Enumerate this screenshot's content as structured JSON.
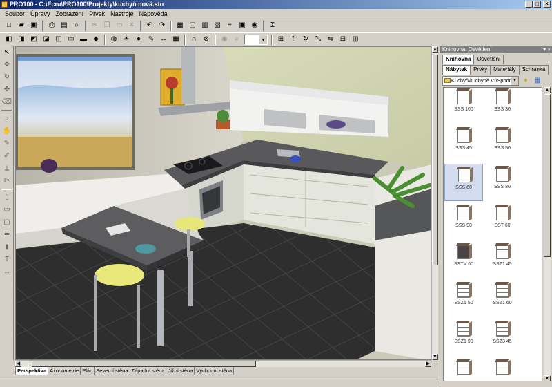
{
  "window": {
    "title": "PRO100 - C:\\Ecru\\PRO100\\Projekty\\kuchyň nová.sto",
    "controls": [
      "_",
      "□",
      "×"
    ]
  },
  "menu": [
    "Soubor",
    "Úpravy",
    "Zobrazení",
    "Prvek",
    "Nástroje",
    "Nápověda"
  ],
  "toolbar1": {
    "icons": [
      "new-doc-icon",
      "open-folder-icon",
      "save-icon",
      "print-preview-icon",
      "print-icon",
      "find-icon",
      "cut-icon",
      "copy-icon",
      "paste-icon",
      "delete-icon",
      "undo-icon",
      "redo-icon",
      "properties-icon",
      "window-icon",
      "layers-icon",
      "group-icon",
      "align-icon",
      "preview-icon",
      "render-icon",
      "sum-icon"
    ],
    "sum_symbol": "Σ"
  },
  "toolbar2": {
    "icons": [
      "view-front-icon",
      "view-left-icon",
      "view-top-icon",
      "view-3d-icon",
      "view-right-icon",
      "view-back-icon",
      "view-bottom-icon",
      "view-iso-icon",
      "camera-icon",
      "light-icon",
      "bulb-icon",
      "paint-icon",
      "measure-icon",
      "grid-icon",
      "magnet-icon",
      "snap-icon",
      "stop-icon",
      "zoom-icon",
      "snap-grid-icon",
      "move-icon",
      "rotate-icon",
      "scale-icon",
      "mirror-icon",
      "distribute-icon",
      "arrange-icon"
    ],
    "zoom_value": ""
  },
  "left_tools": [
    "arrow-icon",
    "select-icon",
    "rotate-tool-icon",
    "move-tool-icon",
    "rubber-icon",
    "zoom-tool-icon",
    "pan-icon",
    "edit-icon",
    "draw-icon",
    "measure-tool-icon",
    "cut-tool-icon",
    "wall-icon",
    "door-icon",
    "window-tool-icon",
    "stairs-icon",
    "column-icon",
    "text-tool-icon",
    "dim-icon"
  ],
  "view_tabs": [
    "Perspektiva",
    "Axonometrie",
    "Plán",
    "Severní stěna",
    "Západní stěna",
    "Jižní stěna",
    "Východní stěna"
  ],
  "active_view_tab": "Perspektiva",
  "panel": {
    "header": "Knihovna, Osvětlení",
    "tabs": [
      "Knihovna",
      "Osvětlení"
    ],
    "subtabs": [
      "Nábytek",
      "Prvky",
      "Materiály",
      "Schránka"
    ],
    "path": "Kuchyň\\kuchyně VI\\Spodní",
    "items": [
      {
        "label": "SSS 100",
        "style": "plain"
      },
      {
        "label": "SSS 30",
        "style": "plain"
      },
      {
        "label": "SSS 45",
        "style": "plain"
      },
      {
        "label": "SSS 50",
        "style": "plain"
      },
      {
        "label": "SSS 60",
        "style": "plain"
      },
      {
        "label": "SSS 80",
        "style": "plain"
      },
      {
        "label": "SSS 90",
        "style": "plain"
      },
      {
        "label": "SST 60",
        "style": "plain"
      },
      {
        "label": "SSTV 60",
        "style": "dark"
      },
      {
        "label": "SSZ1 45",
        "style": "drawers"
      },
      {
        "label": "SSZ1 50",
        "style": "drawers"
      },
      {
        "label": "SSZ1 60",
        "style": "drawers"
      },
      {
        "label": "SSZ1 90",
        "style": "drawers"
      },
      {
        "label": "SSZ3 45",
        "style": "drawers"
      },
      {
        "label": "",
        "style": "drawers"
      },
      {
        "label": "",
        "style": "drawers"
      }
    ],
    "selected_item": "SSS 60"
  }
}
